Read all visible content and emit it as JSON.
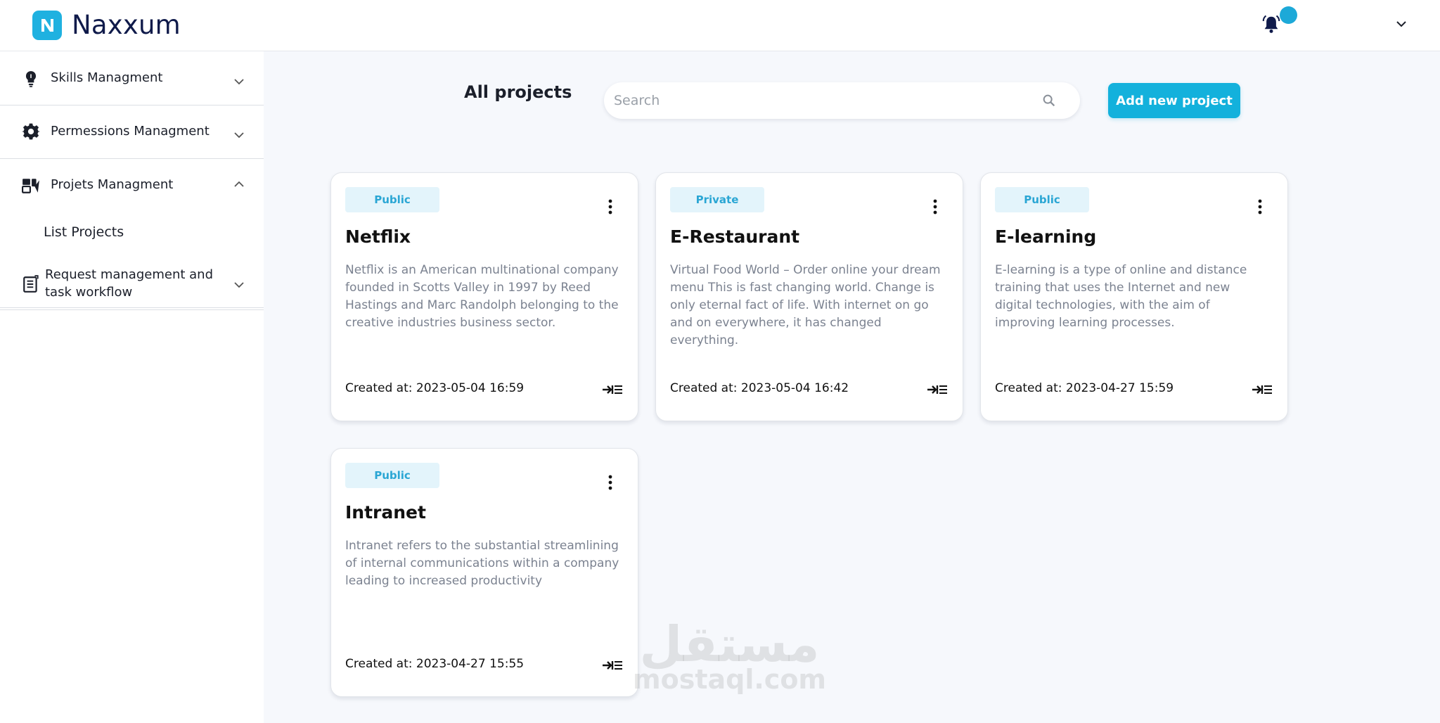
{
  "app": {
    "name": "Naxxum"
  },
  "sidebar": {
    "items": [
      {
        "label": "Skills Managment"
      },
      {
        "label": "Permessions Managment"
      },
      {
        "label": "Projets Managment",
        "subitems": [
          {
            "label": "List Projects"
          }
        ]
      },
      {
        "label": "Request management and task workflow"
      }
    ]
  },
  "main": {
    "title": "All projects",
    "search_placeholder": "Search",
    "add_button": "Add new project",
    "projects": [
      {
        "visibility": "Public",
        "name": "Netflix",
        "description": "Netflix is an American multinational company founded in Scotts Valley in 1997 by Reed Hastings and Marc Randolph belonging to the creative industries business sector.",
        "created": "Created at: 2023-05-04 16:59"
      },
      {
        "visibility": "Private",
        "name": "E-Restaurant",
        "description": "Virtual Food World – Order online your dream menu This is fast changing world. Change is only eternal fact of life. With internet on go and on everywhere, it has changed everything.",
        "created": "Created at: 2023-05-04 16:42"
      },
      {
        "visibility": "Public",
        "name": "E-learning",
        "description": "E-learning is a type of online and distance training that uses the Internet and new digital technologies, with the aim of improving learning processes.",
        "created": "Created at: 2023-04-27 15:59"
      },
      {
        "visibility": "Public",
        "name": "Intranet",
        "description": "Intranet refers to the substantial streamlining of internal communications within a company leading to increased productivity",
        "created": "Created at: 2023-04-27 15:55"
      }
    ]
  },
  "watermark": {
    "arabic": "مستقل",
    "latin": "mostaql.com"
  },
  "colors": {
    "accent": "#13b1dc",
    "badge_bg": "#e3f4fb",
    "badge_text": "#2aa6d4",
    "notification_dot": "#1da9d8"
  }
}
